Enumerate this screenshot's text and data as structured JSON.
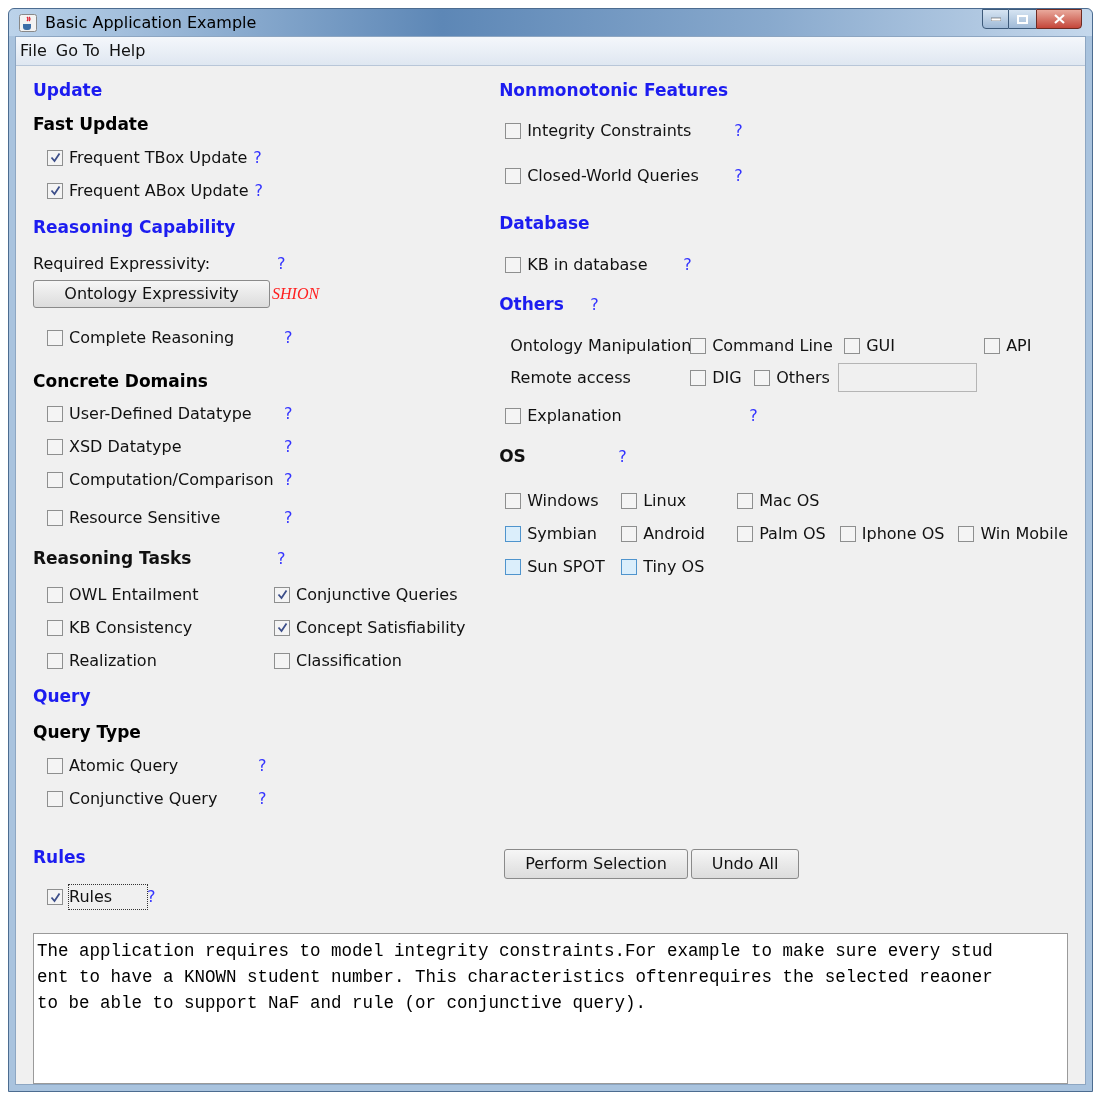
{
  "window": {
    "title": "Basic Application Example"
  },
  "menu": [
    "File",
    "Go To",
    "Help"
  ],
  "update": {
    "heading": "Update",
    "subheading": "Fast Update",
    "items": [
      {
        "label": "Frequent TBox Update",
        "checked": true,
        "help": "?"
      },
      {
        "label": "Frequent ABox Update",
        "checked": true,
        "help": "?"
      }
    ]
  },
  "reasoning_capability": {
    "heading": "Reasoning Capability",
    "required_label": "Required Expressivity:",
    "required_help": "?",
    "button": "Ontology Expressivity",
    "expressivity": "SHION",
    "complete": {
      "label": "Complete Reasoning",
      "checked": false,
      "help": "?"
    }
  },
  "concrete_domains": {
    "heading": "Concrete Domains",
    "items": [
      {
        "label": "User-Defined Datatype",
        "checked": false,
        "help": "?"
      },
      {
        "label": "XSD Datatype",
        "checked": false,
        "help": "?"
      },
      {
        "label": "Computation/Comparison",
        "checked": false,
        "help": "?"
      },
      {
        "label": "Resource Sensitive",
        "checked": false,
        "help": "?"
      }
    ]
  },
  "reasoning_tasks": {
    "heading": "Reasoning Tasks",
    "help": "?",
    "items": [
      {
        "label": "OWL Entailment",
        "checked": false
      },
      {
        "label": "Conjunctive Queries",
        "checked": true
      },
      {
        "label": "KB Consistency",
        "checked": false
      },
      {
        "label": "Concept Satisfiability",
        "checked": true
      },
      {
        "label": "Realization",
        "checked": false
      },
      {
        "label": "Classification",
        "checked": false
      }
    ]
  },
  "query": {
    "heading": "Query",
    "subheading": "Query Type",
    "items": [
      {
        "label": "Atomic Query",
        "checked": false,
        "help": "?"
      },
      {
        "label": "Conjunctive Query",
        "checked": false,
        "help": "?"
      }
    ]
  },
  "rules": {
    "heading": "Rules",
    "item": {
      "label": "Rules",
      "checked": true,
      "focused": true,
      "help": "?"
    }
  },
  "nonmonotonic": {
    "heading": "Nonmonotonic Features",
    "items": [
      {
        "label": "Integrity Constraints",
        "checked": false,
        "help": "?"
      },
      {
        "label": "Closed-World Queries",
        "checked": false,
        "help": "?"
      }
    ]
  },
  "database": {
    "heading": "Database",
    "items": [
      {
        "label": "KB in database",
        "checked": false,
        "help": "?"
      }
    ]
  },
  "others": {
    "heading": "Others",
    "help": "?",
    "ontology_manipulation": {
      "label": "Ontology Manipulation",
      "options": [
        {
          "label": "Command Line",
          "checked": false
        },
        {
          "label": "GUI",
          "checked": false
        },
        {
          "label": "API",
          "checked": false
        }
      ]
    },
    "remote_access": {
      "label": "Remote access",
      "options": [
        {
          "label": "DIG",
          "checked": false
        },
        {
          "label": "Others",
          "checked": false
        }
      ]
    },
    "explanation": {
      "label": "Explanation",
      "checked": false,
      "help": "?"
    }
  },
  "os": {
    "heading": "OS",
    "help": "?",
    "rows": [
      [
        {
          "label": "Windows",
          "checked": false,
          "highlighted": false
        },
        {
          "label": "Linux",
          "checked": false,
          "highlighted": false
        },
        {
          "label": "Mac OS",
          "checked": false,
          "highlighted": false
        }
      ],
      [
        {
          "label": "Symbian",
          "checked": false,
          "highlighted": true
        },
        {
          "label": "Android",
          "checked": false,
          "highlighted": false
        },
        {
          "label": "Palm OS",
          "checked": false,
          "highlighted": false
        },
        {
          "label": "Iphone OS",
          "checked": false,
          "highlighted": false
        },
        {
          "label": "Win Mobile",
          "checked": false,
          "highlighted": false
        }
      ],
      [
        {
          "label": "Sun SPOT",
          "checked": false,
          "highlighted": true
        },
        {
          "label": "Tiny OS",
          "checked": false,
          "highlighted": true
        }
      ]
    ]
  },
  "buttons": [
    "Perform Selection",
    "Undo All"
  ],
  "description": "The application requires to model integrity constraints.For example to make sure every student to have a KNOWN student number. This characteristics oftenrequires the selected reaoner to be able to support NaF and rule (or conjunctive query)."
}
